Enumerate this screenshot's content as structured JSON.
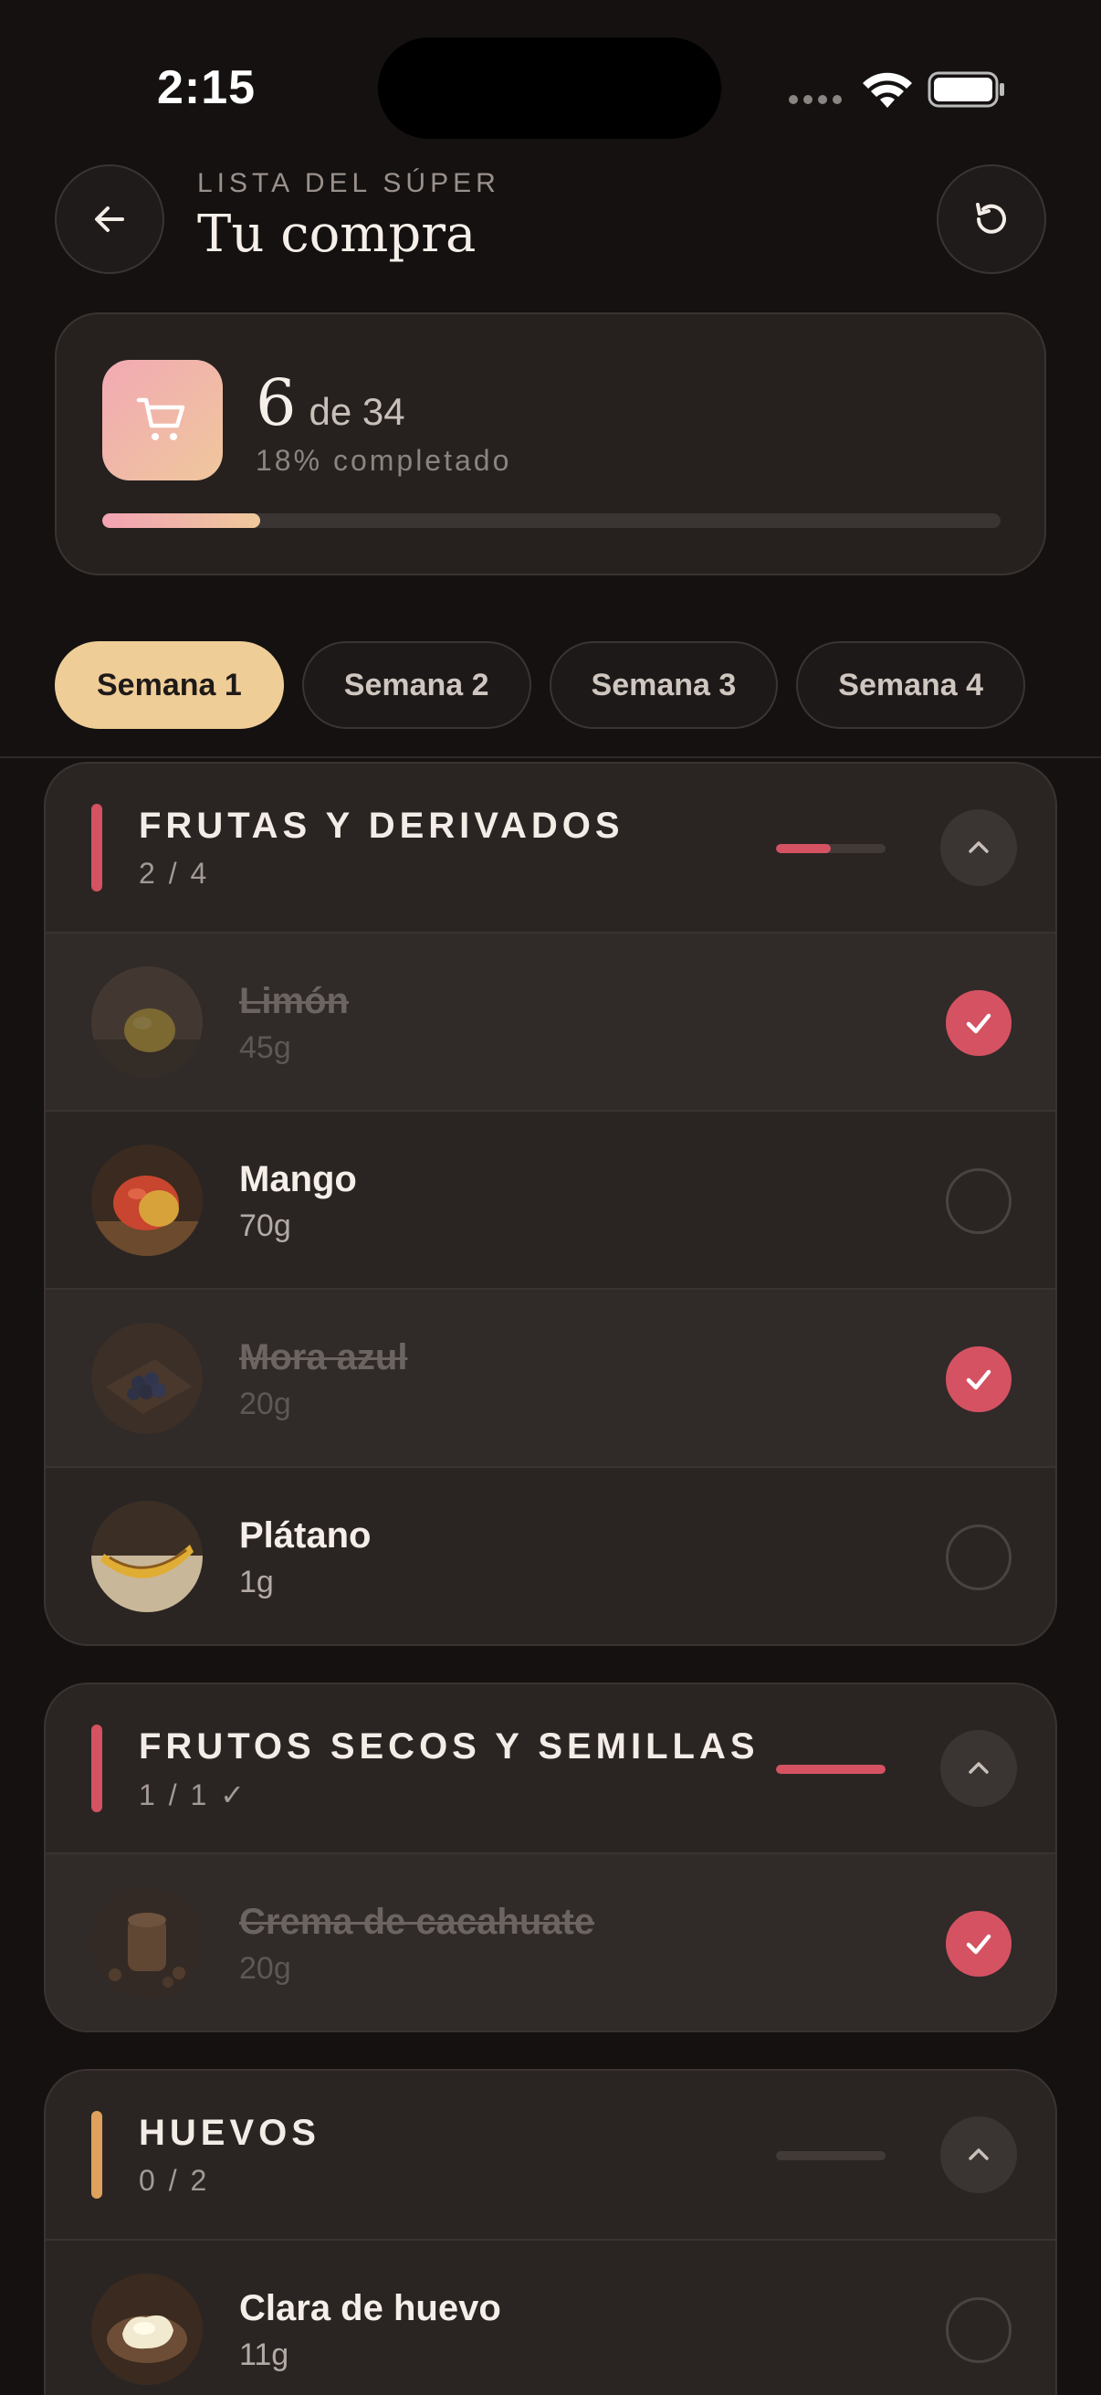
{
  "status_bar": {
    "time": "2:15"
  },
  "header": {
    "eyebrow": "LISTA DEL SÚPER",
    "title": "Tu compra"
  },
  "progress": {
    "done": "6",
    "total_text": "de 34",
    "percent_text": "18% completado",
    "fraction": 0.176
  },
  "colors": {
    "accent_pink": "#d45262",
    "accent_gold": "#e0a15c",
    "gradient_start": "#f2a3b3",
    "gradient_end": "#efc99c",
    "tab_active": "#efcd97"
  },
  "tabs": [
    {
      "label": "Semana 1",
      "active": true
    },
    {
      "label": "Semana 2",
      "active": false
    },
    {
      "label": "Semana 3",
      "active": false
    },
    {
      "label": "Semana 4",
      "active": false
    }
  ],
  "categories": [
    {
      "title": "FRUTAS Y DERIVADOS",
      "count": "2 / 4",
      "fraction": 0.5,
      "accent": "#d45262",
      "items": [
        {
          "name": "Limón",
          "qty": "45g",
          "checked": true,
          "icon": "lemon-photo"
        },
        {
          "name": "Mango",
          "qty": "70g",
          "checked": false,
          "icon": "mango-photo"
        },
        {
          "name": "Mora azul",
          "qty": "20g",
          "checked": true,
          "icon": "blueberries-photo"
        },
        {
          "name": "Plátano",
          "qty": "1g",
          "checked": false,
          "icon": "banana-photo"
        }
      ]
    },
    {
      "title": "FRUTOS SECOS Y SEMILLAS",
      "count": "1 / 1 ✓",
      "fraction": 1.0,
      "accent": "#d45262",
      "items": [
        {
          "name": "Crema de cacahuate",
          "qty": "20g",
          "checked": true,
          "icon": "peanut-butter-photo"
        }
      ]
    },
    {
      "title": "HUEVOS",
      "count": "0 / 2",
      "fraction": 0.0,
      "accent": "#e0a15c",
      "items": [
        {
          "name": "Clara de huevo",
          "qty": "11g",
          "checked": false,
          "icon": "egg-white-photo"
        }
      ]
    }
  ]
}
